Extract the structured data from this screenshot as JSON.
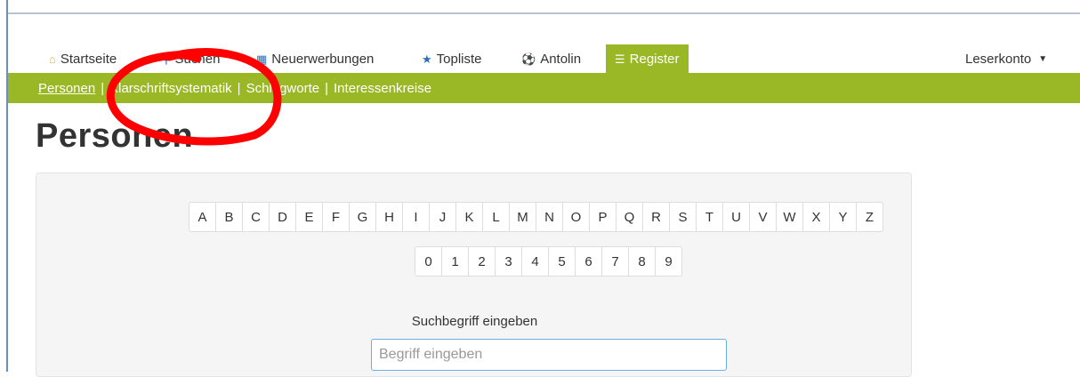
{
  "nav": {
    "items": [
      {
        "label": "Startseite",
        "icon": "home-icon"
      },
      {
        "label": "Suchen",
        "icon": "search-icon"
      },
      {
        "label": "Neuerwerbungen",
        "icon": "calendar-icon"
      },
      {
        "label": "Topliste",
        "icon": "star-icon"
      },
      {
        "label": "Antolin",
        "icon": "soccer-ball-icon"
      },
      {
        "label": "Register",
        "icon": "list-icon",
        "active": true
      }
    ],
    "account": {
      "label": "Leserkonto",
      "icon": "caret-down-icon"
    }
  },
  "subnav": {
    "items": [
      {
        "label": "Personen",
        "active": true
      },
      {
        "label": "Klarschriftsystematik"
      },
      {
        "label": "Schlagworte"
      },
      {
        "label": "Interessenkreise"
      }
    ],
    "separator": "|"
  },
  "page": {
    "title": "Personen"
  },
  "index": {
    "letters": [
      "A",
      "B",
      "C",
      "D",
      "E",
      "F",
      "G",
      "H",
      "I",
      "J",
      "K",
      "L",
      "M",
      "N",
      "O",
      "P",
      "Q",
      "R",
      "S",
      "T",
      "U",
      "V",
      "W",
      "X",
      "Y",
      "Z"
    ],
    "digits": [
      "0",
      "1",
      "2",
      "3",
      "4",
      "5",
      "6",
      "7",
      "8",
      "9"
    ]
  },
  "search": {
    "label": "Suchbegriff eingeben",
    "placeholder": "Begriff eingeben",
    "value": ""
  },
  "colors": {
    "brand_green": "#9ab726",
    "annotation_red": "#ff0000"
  }
}
